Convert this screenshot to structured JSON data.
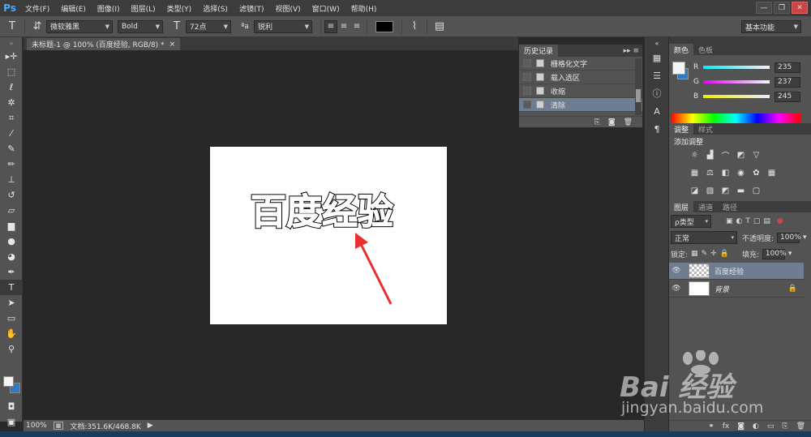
{
  "app": {
    "logo": "Ps"
  },
  "menu": [
    "文件(F)",
    "编辑(E)",
    "图像(I)",
    "图层(L)",
    "类型(Y)",
    "选择(S)",
    "滤镜(T)",
    "视图(V)",
    "窗口(W)",
    "帮助(H)"
  ],
  "window_controls": {
    "minimize": "—",
    "restore": "❐",
    "close": "✕"
  },
  "options": {
    "tool_icon": "T",
    "orient_icon": "⇵",
    "font_family": "微软雅黑",
    "font_style": "Bold",
    "size_icon": "T",
    "font_size": "72点",
    "aa_label": "ªa",
    "antialias": "锐利",
    "text_color": "#000000",
    "workspace": "基本功能"
  },
  "document": {
    "tab_title": "未标题-1 @ 100% (百度经验, RGB/8) *",
    "tab_close": "×",
    "canvas_text": "百度经验"
  },
  "status": {
    "zoom": "100%",
    "doc_info": "文档:351.6K/468.8K",
    "arrow": "▶"
  },
  "history": {
    "tabs": [
      "历史记录"
    ],
    "menu": "▸▸ ≡",
    "items": [
      {
        "label": "栅格化文字",
        "selected": false
      },
      {
        "label": "载入选区",
        "selected": false
      },
      {
        "label": "收缩",
        "selected": false
      },
      {
        "label": "清除",
        "selected": true
      }
    ],
    "footer_icons": [
      "new-doc-from-state-icon",
      "snapshot-icon",
      "trash-icon"
    ]
  },
  "color": {
    "tabs": [
      "颜色",
      "色板"
    ],
    "r_label": "R",
    "g_label": "G",
    "b_label": "B",
    "r": "235",
    "g": "237",
    "b": "245",
    "fg": "#ebedf5",
    "bg": "#2e78c8"
  },
  "adjustments": {
    "tabs": [
      "调整",
      "样式"
    ],
    "title": "添加调整"
  },
  "layers": {
    "tabs": [
      "图层",
      "通道",
      "路径"
    ],
    "filter_kind": "ρ类型",
    "blend_mode": "正常",
    "opacity_label": "不透明度:",
    "opacity": "100%",
    "lock_label": "锁定:",
    "fill_label": "填充:",
    "fill": "100%",
    "items": [
      {
        "name": "百度经验",
        "selected": true,
        "locked": false
      },
      {
        "name": "背景",
        "selected": false,
        "locked": true
      }
    ]
  },
  "watermark": {
    "brand": "Bai 经验",
    "url": "jingyan.baidu.com"
  }
}
